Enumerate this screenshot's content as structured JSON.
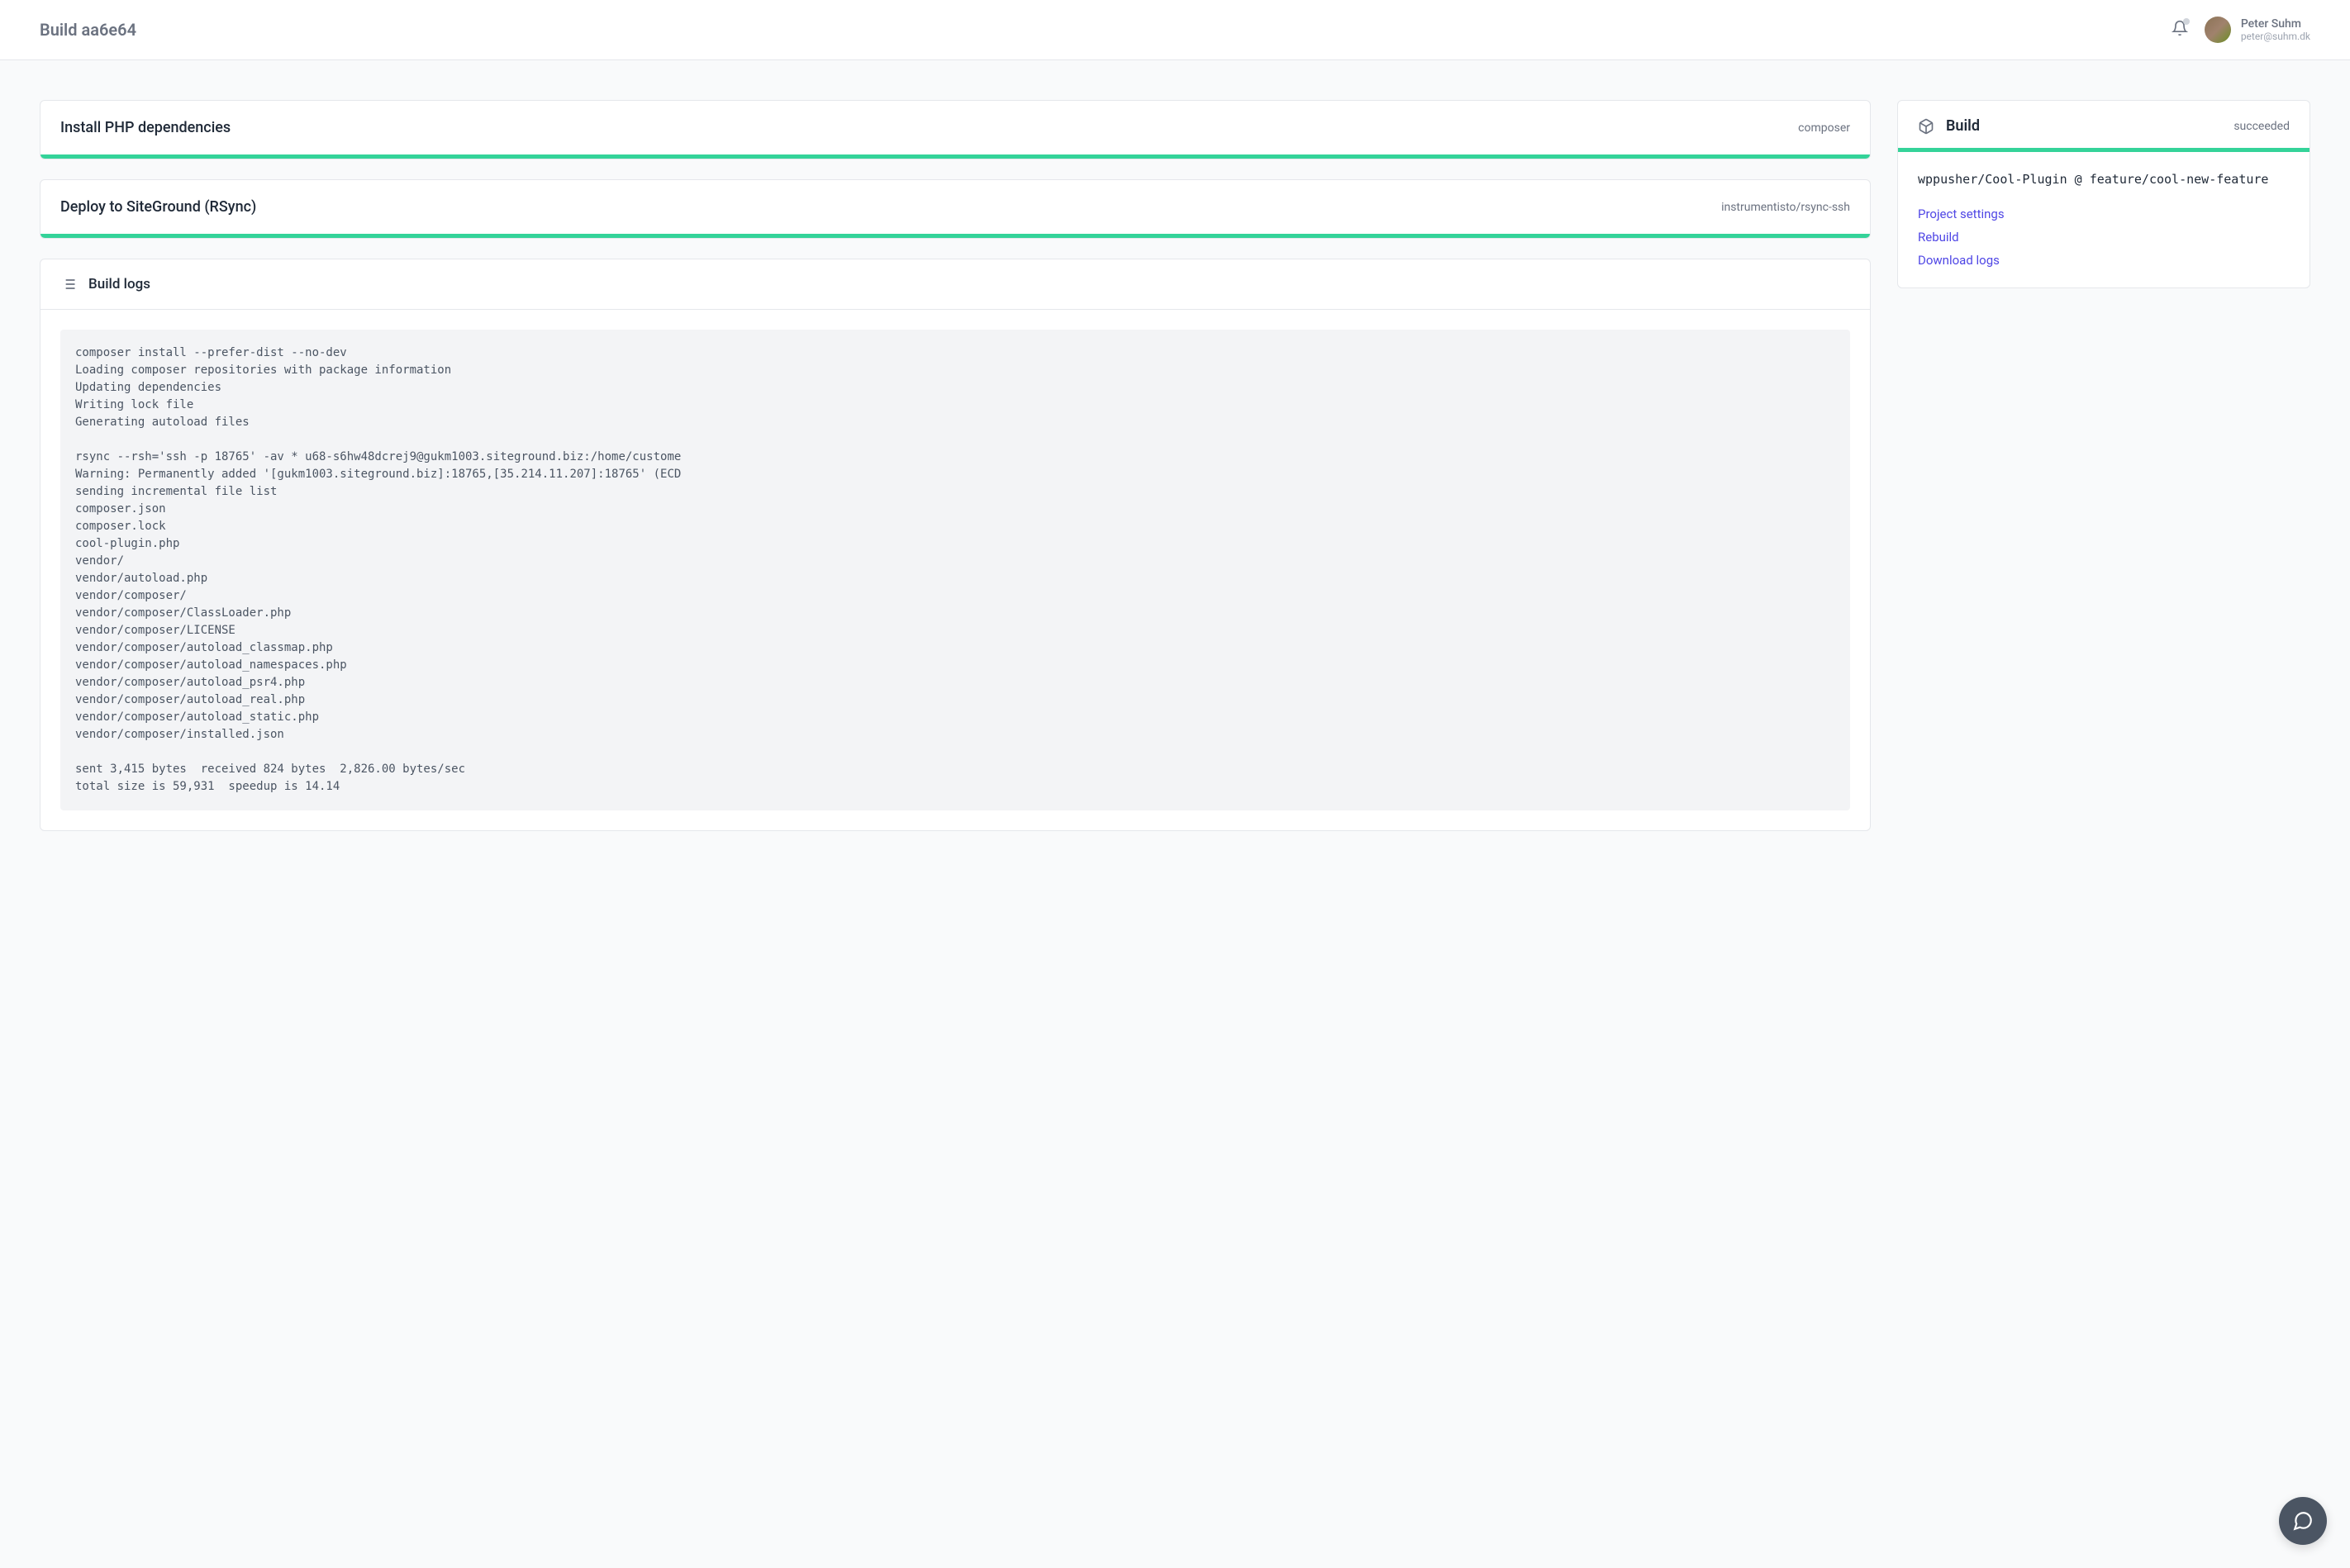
{
  "header": {
    "title": "Build aa6e64",
    "user": {
      "name": "Peter Suhm",
      "email": "peter@suhm.dk"
    }
  },
  "steps": [
    {
      "title": "Install PHP dependencies",
      "meta": "composer"
    },
    {
      "title": "Deploy to SiteGround (RSync)",
      "meta": "instrumentisto/rsync-ssh"
    }
  ],
  "logs": {
    "title": "Build logs",
    "content": "composer install --prefer-dist --no-dev\nLoading composer repositories with package information\nUpdating dependencies\nWriting lock file\nGenerating autoload files\n\nrsync --rsh='ssh -p 18765' -av * u68-s6hw48dcrej9@gukm1003.siteground.biz:/home/custome\nWarning: Permanently added '[gukm1003.siteground.biz]:18765,[35.214.11.207]:18765' (ECD\nsending incremental file list\ncomposer.json\ncomposer.lock\ncool-plugin.php\nvendor/\nvendor/autoload.php\nvendor/composer/\nvendor/composer/ClassLoader.php\nvendor/composer/LICENSE\nvendor/composer/autoload_classmap.php\nvendor/composer/autoload_namespaces.php\nvendor/composer/autoload_psr4.php\nvendor/composer/autoload_real.php\nvendor/composer/autoload_static.php\nvendor/composer/installed.json\n\nsent 3,415 bytes  received 824 bytes  2,826.00 bytes/sec\ntotal size is 59,931  speedup is 14.14"
  },
  "build": {
    "title": "Build",
    "status": "succeeded",
    "repo": "wppusher/Cool-Plugin @ feature/cool-new-feature",
    "links": {
      "settings": "Project settings",
      "rebuild": "Rebuild",
      "download": "Download logs"
    }
  }
}
